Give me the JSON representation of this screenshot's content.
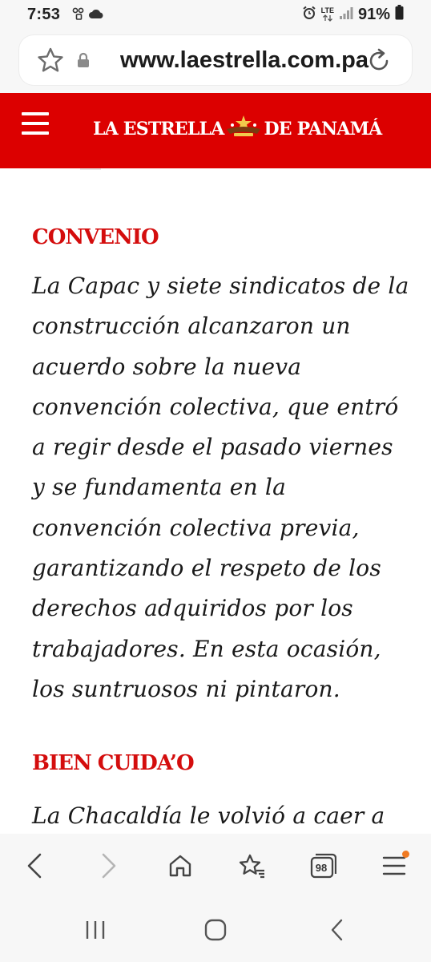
{
  "status_bar": {
    "time": "7:53",
    "network": "LTE",
    "battery_percent": "91%"
  },
  "browser": {
    "url": "www.laestrella.com.pa",
    "open_tabs": "98"
  },
  "site": {
    "logo_left": "LA ESTRELLA",
    "logo_right": "DE PANAMÁ"
  },
  "article": {
    "sections": [
      {
        "heading": "CONVENIO",
        "lines": [
          "La Capac y siete sindicatos de la",
          "construcción alcanzaron un",
          "acuerdo sobre la nueva",
          "convención colectiva, que entró",
          "a regir desde el pasado viernes",
          "y se fundamenta en la",
          "convención colectiva previa,",
          "garantizando el respeto de los",
          "derechos adquiridos por los",
          "trabajadores. En esta ocasión,",
          "los suntruosos ni pintaron."
        ]
      },
      {
        "heading": "BIEN CUIDA’O",
        "lines": [
          "La Chacaldía le volvió a caer a"
        ]
      }
    ]
  },
  "icons": {
    "accent": "#dc0000",
    "heading_color": "#d40d0d",
    "notification_dot": "#f07a22"
  }
}
